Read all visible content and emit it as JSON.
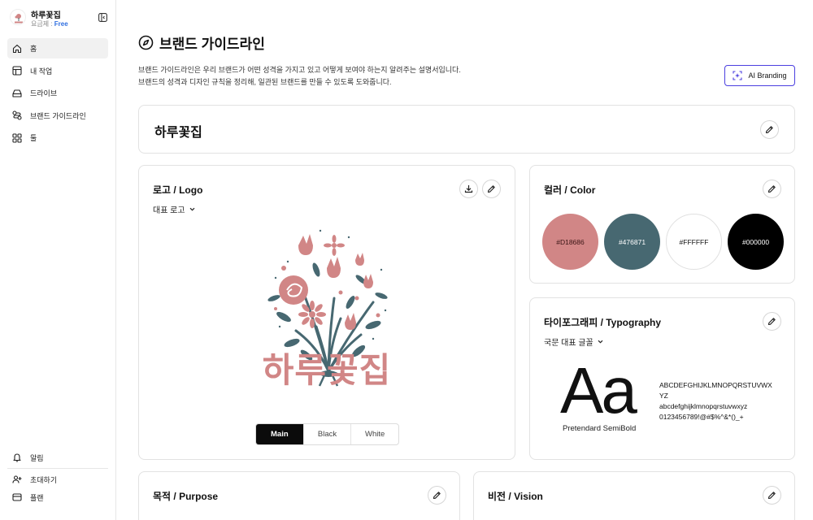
{
  "sidebar": {
    "workspace_name": "하루꽃집",
    "plan_prefix": "요금제 : ",
    "plan_value": "Free",
    "nav": [
      {
        "label": "홈",
        "icon": "home-icon"
      },
      {
        "label": "내 작업",
        "icon": "layout-icon"
      },
      {
        "label": "드라이브",
        "icon": "drive-icon"
      },
      {
        "label": "브랜드 가이드라인",
        "icon": "brand-guideline-icon"
      },
      {
        "label": "툴",
        "icon": "grid-icon"
      }
    ],
    "bottom": [
      {
        "label": "알림",
        "icon": "bell-icon"
      },
      {
        "label": "초대하기",
        "icon": "user-plus-icon"
      },
      {
        "label": "플랜",
        "icon": "credit-card-icon"
      }
    ]
  },
  "header": {
    "title": "브랜드 가이드라인",
    "desc_line1": "브랜드 가이드라인은 우리 브랜드가 어떤 성격을 가지고 있고 어떻게 보여야 하는지 알려주는 설명서입니다.",
    "desc_line2": "브랜드의 성격과 디자인 규칙을 정리해, 일관된 브랜드를 만들 수 있도록 도와줍니다.",
    "ai_button": "AI Branding",
    "accent": "#4b3fe0"
  },
  "brand": {
    "name": "하루꽃집"
  },
  "logo": {
    "title": "로고 / Logo",
    "dropdown": "대표 로고",
    "logo_text": "하루꽃집",
    "variants": [
      "Main",
      "Black",
      "White"
    ],
    "selected_variant": "Main"
  },
  "color": {
    "title": "컬러 / Color",
    "swatches": [
      {
        "hex": "#D18686"
      },
      {
        "hex": "#476871"
      },
      {
        "hex": "#FFFFFF"
      },
      {
        "hex": "#000000"
      }
    ]
  },
  "typography": {
    "title": "타이포그래피 / Typography",
    "dropdown": "국문 대표 글꼴",
    "specimen": "Aa",
    "font_name": "Pretendard SemiBold",
    "sample_upper": "ABCDEFGHIJKLMNOPQRSTUVWXYZ",
    "sample_lower": "abcdefghijklmnopqrstuvwxyz",
    "sample_digits": "0123456789!@#$%^&*()_+"
  },
  "purpose": {
    "title": "목적 / Purpose"
  },
  "vision": {
    "title": "비전 / Vision"
  }
}
